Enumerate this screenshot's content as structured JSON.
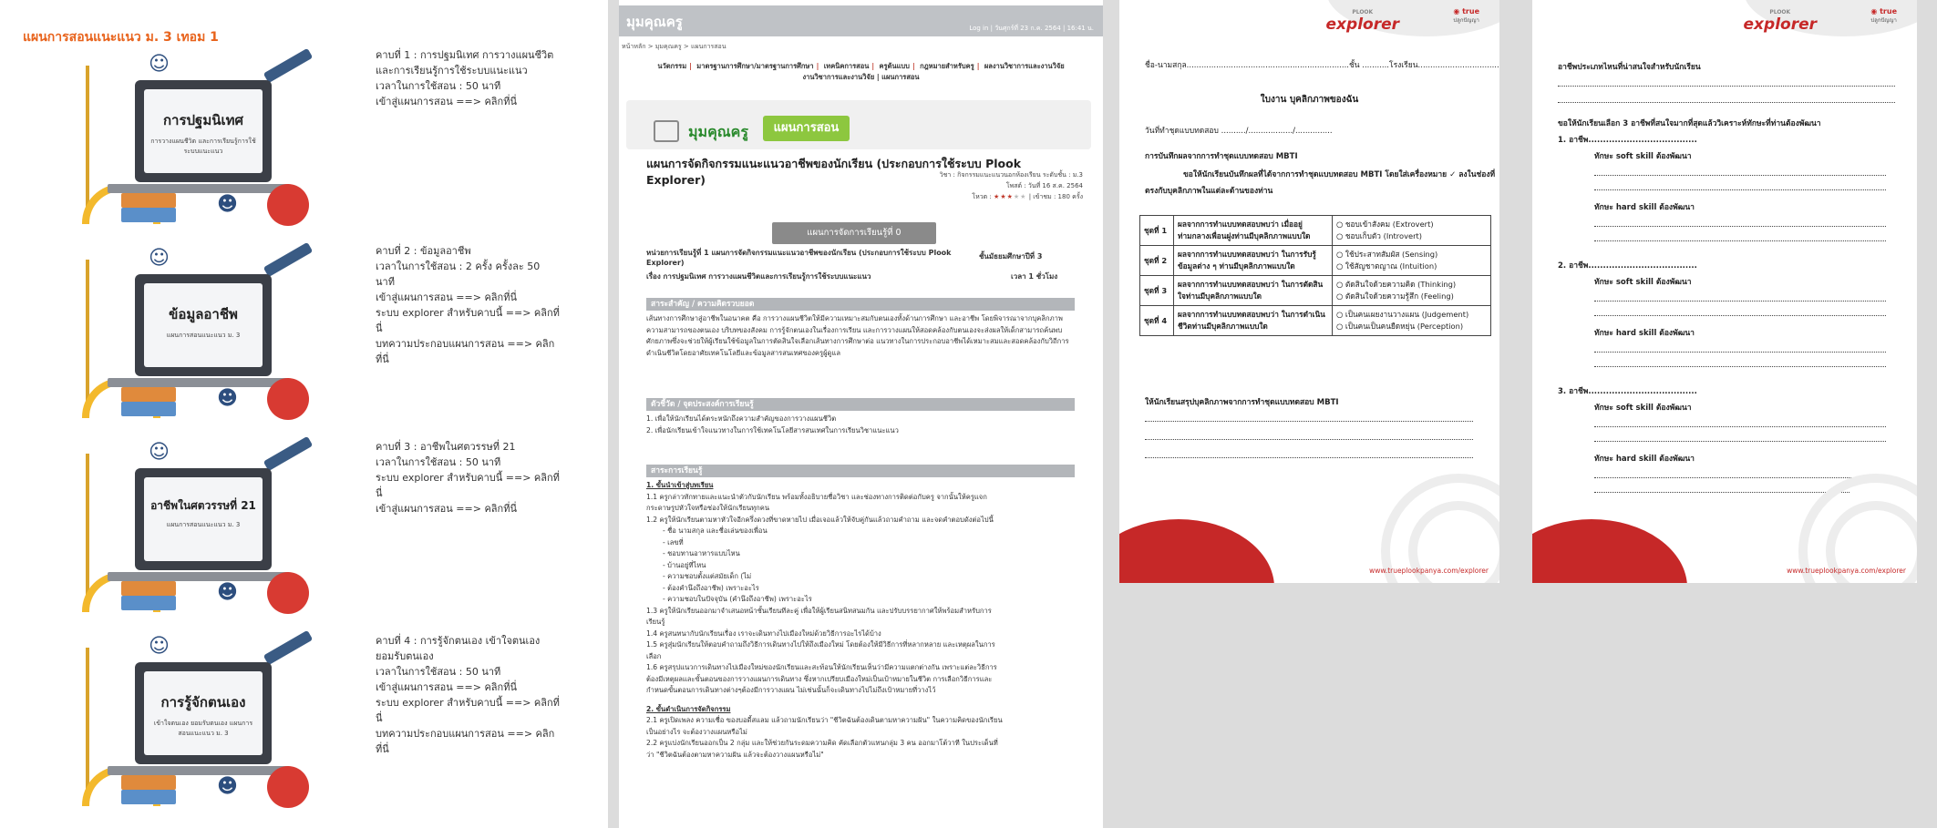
{
  "panel1": {
    "title": "แผนการสอนแนะแนว ม. 3 เทอม 1",
    "lessons": [
      {
        "cover_title": "การปฐมนิเทศ",
        "cover_subtitle": "การวางแผนชีวิต และการเรียนรู้การใช้ระบบแนะแนว",
        "lines": [
          "คาบที่ 1 : การปฐมนิเทศ การวางแผนชีวิต",
          "และการเรียนรู้การใช้ระบบแนะแนว",
          "เวลาในการใช้สอน : 50 นาที",
          "เข้าสู่แผนการสอน ==> คลิกที่นี่"
        ]
      },
      {
        "cover_title": "ข้อมูลอาชีพ",
        "cover_subtitle": "แผนการสอนแนะแนว ม. 3",
        "lines": [
          "คาบที่ 2 : ข้อมูลอาชีพ",
          "เวลาในการใช้สอน : 2 ครั้ง ครั้งละ 50",
          "นาที",
          "เข้าสู่แผนการสอน ==> คลิกที่นี่",
          "ระบบ explorer สำหรับคาบนี้ ==> คลิกที่",
          "นี่",
          "บทความประกอบแผนการสอน ==> คลิก",
          "ที่นี่"
        ]
      },
      {
        "cover_title": "อาชีพในศตวรรษที่ 21",
        "cover_subtitle": "แผนการสอนแนะแนว ม. 3",
        "lines": [
          "คาบที่ 3 : อาชีพในศตวรรษที่ 21",
          "เวลาในการใช้สอน : 50 นาที",
          "ระบบ explorer สำหรับคาบนี้ ==> คลิกที่",
          "นี่",
          "เข้าสู่แผนการสอน ==> คลิกที่นี่"
        ]
      },
      {
        "cover_title": "การรู้จักตนเอง",
        "cover_subtitle": "เข้าใจตนเอง ยอมรับตนเอง แผนการสอนแนะแนว ม. 3",
        "lines": [
          "คาบที่ 4 : การรู้จักตนเอง เข้าใจตนเอง",
          "ยอมรับตนเอง",
          "เวลาในการใช้สอน : 50 นาที",
          "เข้าสู่แผนการสอน ==> คลิกที่นี่",
          "ระบบ explorer สำหรับคาบนี้ ==> คลิกที่",
          "นี่",
          "บทความประกอบแผนการสอน ==> คลิก",
          "ที่นี่"
        ]
      }
    ]
  },
  "panel2": {
    "header_title": "มุมคุณครู",
    "header_date": "Log in | วันศุกร์ที่ 23 ก.ค. 2564 | 16:41 น.",
    "breadcrumb": "หน้าหลัก > มุมคุณครู > แผนการสอน",
    "nav": [
      "นวัตกรรม",
      "มาตรฐานการศึกษา/มาตรฐานการศึกษา",
      "เทคนิคการสอน",
      "ครูต้นแบบ",
      "กฎหมายสำหรับครู",
      "ผลงานวิชาการและงานวิจัย"
    ],
    "nav_line2": "งานวิชาการและงานวิจัย | แผนการสอน",
    "banner_text": "มุมคุณครู",
    "banner_pill": "แผนการสอน",
    "plan_title": "แผนการจัดกิจกรรมแนะแนวอาชีพของนักเรียน (ประกอบการใช้ระบบ Plook Explorer)",
    "meta_subject": "วิชา : กิจกรรมแนะแนวนอกห้องเรียน   ระดับชั้น : ม.3",
    "meta_date": "โพสต์ : วันที่ 16 ส.ค. 2564",
    "meta_votes": "โหวต :",
    "meta_views": "| เข้าชม : 180 ครั้ง",
    "rating": 3,
    "lesson_button": "แผนการจัดการเรียนรู้ที่ 0",
    "unit_left": "หน่วยการเรียนรู้ที่ 1 แผนการจัดกิจกรรมแนะแนวอาชีพของนักเรียน (ประกอบการใช้ระบบ Plook Explorer)",
    "unit_right": "ชั้นมัธยมศึกษาปีที่ 3",
    "topic_left": "เรื่อง การปฐมนิเทศ การวางแผนชีวิตและการเรียนรู้การใช้ระบบแนะแนว",
    "topic_right": "เวลา 1 ชั่วโมง",
    "sec1": "สาระสำคัญ / ความคิดรวบยอด",
    "sec1_text": "เส้นทางการศึกษาสู่อาชีพในอนาคต คือ การวางแผนชีวิตให้มีความเหมาะสมกับตนเองทั้งด้านการศึกษา และอาชีพ โดยพิจารณาจากบุคลิกภาพ ความสามารถของตนเอง บริบทของสังคม การรู้จักตนเองในเรื่องการเรียน และการวางแผนให้สอดคล้องกับตนเองจะส่งผลให้เด็กสามารถค้นพบศักยภาพซึ่งจะช่วยให้ผู้เรียนใช้ข้อมูลในการตัดสินใจเลือกเส้นทางการศึกษาต่อ แนวทางในการประกอบอาชีพได้เหมาะสมและสอดคล้องกับวิถีการดำเนินชีวิตโดยอาศัยเทคโนโลยีและข้อมูลสารสนเทศของครูผู้ดูแล",
    "sec2": "ตัวชี้วัด / จุดประสงค์การเรียนรู้",
    "sec2_items": [
      "1. เพื่อให้นักเรียนได้ตระหนักถึงความสำคัญของการวางแผนชีวิต",
      "2. เพื่อนักเรียนเข้าใจแนวทางในการใช้เทคโนโลยีสารสนเทศในการเรียนวิชาแนะแนว"
    ],
    "sec3": "สาระการเรียนรู้",
    "steps_head": "1. ขั้นนำเข้าสู่บทเรียน",
    "steps": [
      "1.1 ครูกล่าวทักทายและแนะนำตัวกับนักเรียน พร้อมทั้งอธิบายชื่อวิชา และช่องทางการติดต่อกับครู จากนั้นให้ครูแจก",
      "กระดาษรูปหัวใจหรือช่องให้นักเรียนทุกคน",
      "1.2 ครูให้นักเรียนตามหาหัวใจอีกครึ่งดวงที่ขาดหายไป เมื่อเจอแล้วให้จับคู่กันแล้วถามคำถาม และจดคำตอบดังต่อไปนี้",
      "- ชื่อ นามสกุล และชื่อเล่นของเพื่อน",
      "- เลขที่",
      "- ชอบทานอาหารแบบไหน",
      "- บ้านอยู่ที่ไหน",
      "- ความชอบตั้งแต่สมัยเด็ก (ไม่",
      "- ต้องคำนึงถึงอาชีพ) เพราะอะไร",
      "- ความชอบในปัจจุบัน (คำนึงถึงอาชีพ) เพราะอะไร",
      "1.3 ครูให้นักเรียนออกมาจำเสนอหน้าชั้นเรียนทีละคู่ เพื่อให้ผู้เรียนสนิทสนมกัน และปรับบรรยากาศให้พร้อมสำหรับการ",
      "เรียนรู้",
      "1.4 ครูสนทนากับนักเรียนเรื่อง เราจะเดินทางไปเมืองใหม่ด้วยวิธีการอะไรได้บ้าง",
      "1.5 ครูสุ่มนักเรียนให้ตอบคำถามถึงวิธีการเดินทางไปให้ถึงเมืองใหม่ โดยต้องให้มีวิธีการที่หลากหลาย และเหตุผลในการ",
      "เลือก",
      "1.6 ครูสรุปแนวการเดินทางไปเมืองใหม่ของนักเรียนและสะท้อนให้นักเรียนเห็นว่ามีความแตกต่างกัน เพราะแต่ละวิธีการ",
      "ต้องมีเหตุผลและขั้นตอนของการวางแผนการเดินทาง ซึ่งหากเปรียบเมืองใหม่เป็นเป้าหมายในชีวิต การเลือกวิธีการและ",
      "กำหนดขั้นตอนการเดินทางต่างๆต้องมีการวางแผน ไม่เช่นนั้นก็จะเดินทางไปไม่ถึงเป้าหมายที่วางไว้"
    ],
    "steps2_head": "2. ขั้นดำเนินการจัดกิจกรรม",
    "steps2": [
      "2.1 ครูเปิดเพลง ความเชื่อ ของบอดี้สแลม แล้วถามนักเรียนว่า \"ชีวิตฉันต้องเดินตามหาความฝัน\" ในความคิดของนักเรียน",
      "เป็นอย่างไร จะต้องวางแผนหรือไม่",
      "2.2 ครูแบ่งนักเรียนออกเป็น 2 กลุ่ม และให้ช่วยกันระดมความคิด คัดเลือกตัวแทนกลุ่ม 3 คน ออกมาโต้วาที ในประเด็นที่",
      "ว่า \"ชีวิตฉันต้องตามหาความฝัน แล้วจะต้องวางแผนหรือไม่\""
    ]
  },
  "worksheet1": {
    "logo": "explorer",
    "logo_small": "PLOOK",
    "true_brand": "true",
    "true_sub": "ปลูกปัญญา",
    "name_line": "ชื่อ-นามสกุล..................................................................ชั้น ...........โรงเรียน.................................................",
    "heading": "ใบงาน บุคลิกภาพของฉัน",
    "date_line": "วันที่ทำชุดแบบทดสอบ ........../................../...............",
    "record_head": "การบันทึกผลจากการทำชุดแบบทดสอบ MBTI",
    "instr_1": "ขอให้นักเรียนบันทึกผลที่ได้จากการทำชุดแบบทดสอบ MBTI โดยใส่เครื่องหมาย  ✓  ลงในช่องที่",
    "instr_2": "ตรงกับบุคลิกภาพในแต่ละด้านของท่าน",
    "rows": [
      {
        "set": "ชุดที่ 1",
        "q": "ผลจากการทำแบบทดสอบพบว่า เมื่ออยู่ท่ามกลางเพื่อนฝูงท่านมีบุคลิกภาพแบบใด",
        "a": "ชอบเข้าสังคม (Extrovert)",
        "b": "ชอบเก็บตัว (Introvert)"
      },
      {
        "set": "ชุดที่ 2",
        "q": "ผลจากการทำแบบทดสอบพบว่า ในการรับรู้ข้อมูลต่าง ๆ ท่านมีบุคลิกภาพแบบใด",
        "a": "ใช้ประสาทสัมผัส (Sensing)",
        "b": "ใช้สัญชาตญาณ (Intuition)"
      },
      {
        "set": "ชุดที่ 3",
        "q": "ผลจากการทำแบบทดสอบพบว่า ในการตัดสินใจท่านมีบุคลิกภาพแบบใด",
        "a": "ตัดสินใจด้วยความคิด (Thinking)",
        "b": "ตัดสินใจด้วยความรู้สึก (Feeling)"
      },
      {
        "set": "ชุดที่ 4",
        "q": "ผลจากการทำแบบทดสอบพบว่า ในการดำเนินชีวิตท่านมีบุคลิกภาพแบบใด",
        "a": "เป็นคนเผยงานวางแผน (Judgement)",
        "b": "เป็นคนเป็นคนยืดหยุ่น (Perception)"
      }
    ],
    "summary_head": "ให้นักเรียนสรุปบุคลิกภาพจากการทำชุดแบบทดสอบ MBTI",
    "url": "www.trueplookpanya.com/explorer"
  },
  "worksheet2": {
    "logo": "explorer",
    "logo_small": "PLOOK",
    "true_brand": "true",
    "true_sub": "ปลูกปัญญา",
    "q1": "อาชีพประเภทไหนที่น่าสนใจสำหรับนักเรียน",
    "q2": "ขอให้นักเรียนเลือก 3 อาชีพที่สนใจมากที่สุดแล้ววิเคราะห์ทักษะที่ท่านต้องพัฒนา",
    "items": [
      {
        "no": "1. อาชีพ.....................................",
        "soft": "ทักษะ soft skill ต้องพัฒนา",
        "hard": "ทักษะ hard skill ต้องพัฒนา"
      },
      {
        "no": "2. อาชีพ.....................................",
        "soft": "ทักษะ soft skill ต้องพัฒนา",
        "hard": "ทักษะ hard skill ต้องพัฒนา"
      },
      {
        "no": "3. อาชีพ.....................................",
        "soft": "ทักษะ soft skill ต้องพัฒนา",
        "hard": "ทักษะ hard skill ต้องพัฒนา"
      }
    ],
    "url": "www.trueplookpanya.com/explorer"
  }
}
